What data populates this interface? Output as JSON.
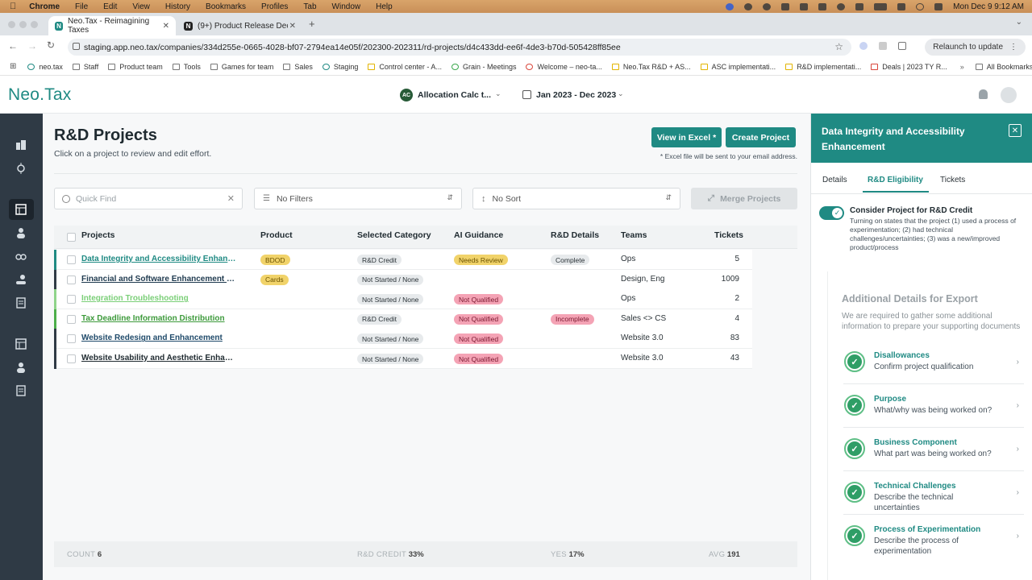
{
  "mac_menu": {
    "items": [
      "Chrome",
      "File",
      "Edit",
      "View",
      "History",
      "Bookmarks",
      "Profiles",
      "Tab",
      "Window",
      "Help"
    ],
    "clock": "Mon Dec 9  9:12 AM"
  },
  "browser": {
    "tabs": [
      {
        "title": "Neo.Tax - Reimagining Taxes"
      },
      {
        "title": "(9+) Product Release Decem"
      }
    ],
    "url": "staging.app.neo.tax/companies/334d255e-0665-4028-bf07-2794ea14e05f/202300-202311/rd-projects/d4c433dd-ee6f-4de3-b70d-505428ff85ee",
    "relaunch_label": "Relaunch to update",
    "bookmarks": [
      "neo.tax",
      "Staff",
      "Product team",
      "Tools",
      "Games for team",
      "Sales",
      "Staging",
      "Control center - A...",
      "Grain - Meetings",
      "Welcome – neo-ta...",
      "Neo.Tax R&D + AS...",
      "ASC implementati...",
      "R&D implementati...",
      "Deals | 2023 TY R..."
    ],
    "all_bookmarks": "All Bookmarks"
  },
  "app": {
    "logo": "Neo.Tax",
    "allocation": {
      "badge": "AC",
      "label": "Allocation Calc t..."
    },
    "date_range": "Jan 2023 - Dec 2023"
  },
  "page": {
    "title": "R&D Projects",
    "subtitle": "Click on a project to review and edit effort.",
    "view_excel": "View in Excel *",
    "create_project": "Create Project",
    "excel_note": "* Excel file will be sent to your email address.",
    "quick_find_placeholder": "Quick Find",
    "filter_label": "No Filters",
    "sort_label": "No Sort",
    "merge_label": "Merge Projects"
  },
  "table": {
    "headers": [
      "Projects",
      "Product",
      "Selected Category",
      "AI Guidance",
      "R&D Details",
      "Teams",
      "Tickets"
    ],
    "rows": [
      {
        "name": "Data Integrity and Accessibility Enhance...",
        "product": "BDOD",
        "category": "R&D Credit",
        "guidance": "Needs Review",
        "details": "Complete",
        "teams": "Ops",
        "tickets": "5",
        "bar": "#1f8a83",
        "name_color": "#1f8a83"
      },
      {
        "name": "Financial and Software Enhancement for ...",
        "product": "Cards",
        "category": "Not Started / None",
        "guidance": "",
        "details": "",
        "teams": "Design, Eng",
        "tickets": "1009",
        "bar": "#2f3a45",
        "name_color": "#1f3a4f"
      },
      {
        "name": "Integration Troubleshooting",
        "product": "",
        "category": "Not Started / None",
        "guidance": "Not Qualified",
        "details": "",
        "teams": "Ops",
        "tickets": "2",
        "bar": "#8fd48a",
        "name_color": "#7bcf78"
      },
      {
        "name": "Tax Deadline Information Distribution",
        "product": "",
        "category": "R&D Credit",
        "guidance": "Not Qualified",
        "details": "Incomplete",
        "teams": "Sales <> CS",
        "tickets": "4",
        "bar": "#4cae4a",
        "name_color": "#3d9a3b"
      },
      {
        "name": "Website Redesign and Enhancement",
        "product": "",
        "category": "Not Started / None",
        "guidance": "Not Qualified",
        "details": "",
        "teams": "Website 3.0",
        "tickets": "83",
        "bar": "#2f3a45",
        "name_color": "#1f4a6a"
      },
      {
        "name": "Website Usability and Aesthetic Enhance...",
        "product": "",
        "category": "Not Started / None",
        "guidance": "Not Qualified",
        "details": "",
        "teams": "Website 3.0",
        "tickets": "43",
        "bar": "#2f3a45",
        "name_color": "#1f2a30"
      }
    ]
  },
  "footer": {
    "count_label": "COUNT",
    "count": "6",
    "credit_label": "R&D CREDIT",
    "credit": "33%",
    "yes_label": "YES",
    "yes": "17%",
    "avg_label": "AVG",
    "avg": "191"
  },
  "panel": {
    "title": "Data Integrity and Accessibility Enhancement",
    "tabs": [
      "Details",
      "R&D Eligibility",
      "Tickets"
    ],
    "consider_title": "Consider Project for R&D Credit",
    "consider_desc": "Turning on states that the project (1) used a process of experimentation; (2) had technical challenges/uncertainties; (3) was a new/improved product/process",
    "additional_title": "Additional Details for Export",
    "additional_desc": "We are required to gather some additional information to prepare your supporting documents",
    "steps": [
      {
        "title": "Disallowances",
        "sub": "Confirm project qualification"
      },
      {
        "title": "Purpose",
        "sub": "What/why was being worked on?"
      },
      {
        "title": "Business Component",
        "sub": "What part was being worked on?"
      },
      {
        "title": "Technical Challenges",
        "sub": "Describe the technical uncertainties"
      },
      {
        "title": "Process of Experimentation",
        "sub": "Describe the process of experimentation"
      }
    ]
  },
  "colors": {
    "accent": "#1f8a83",
    "nav": "#2f3a45",
    "pill_yellow": "#f1d36a",
    "pill_grey": "#e7eaec",
    "pill_red": "#f4a3b5"
  }
}
